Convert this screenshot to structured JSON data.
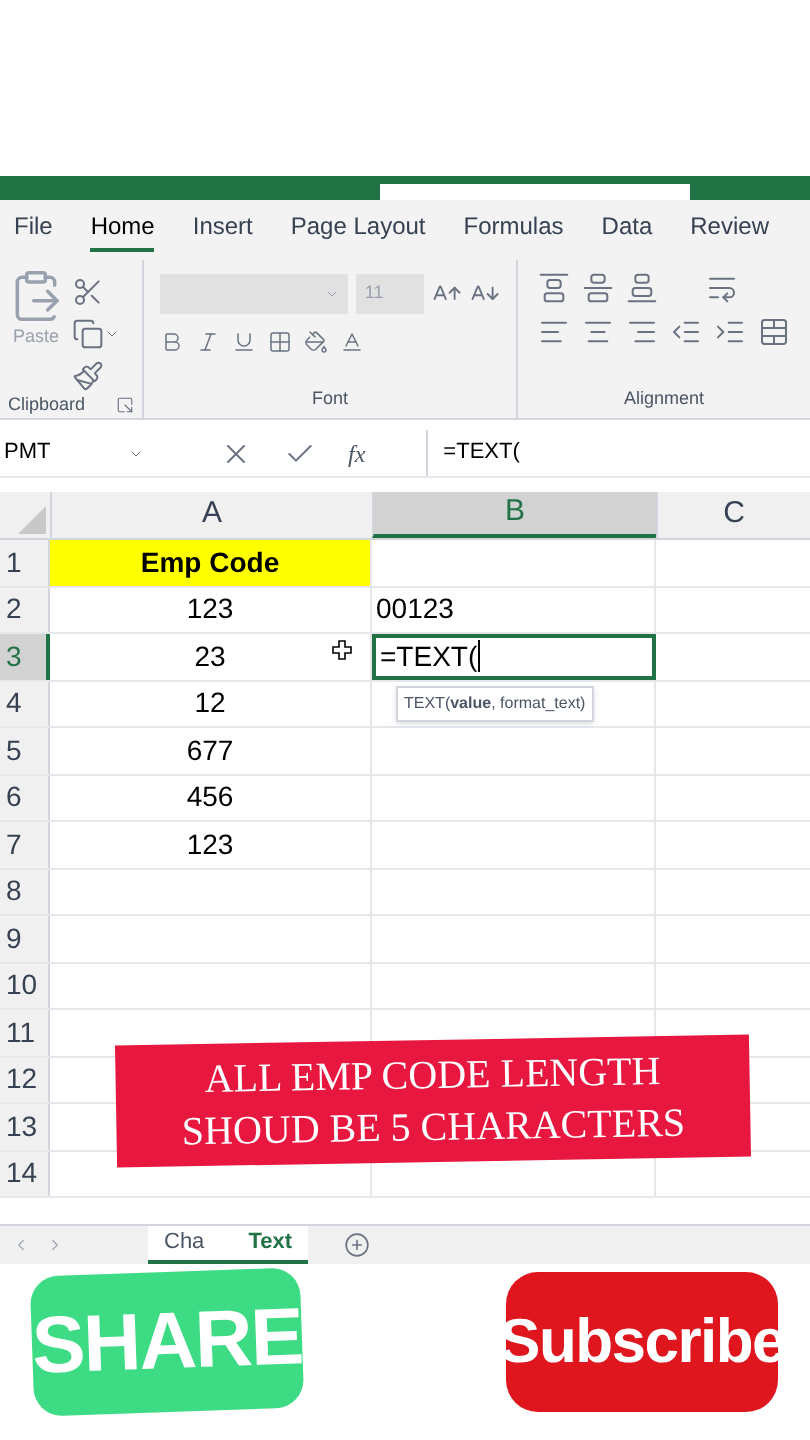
{
  "ribbon_tabs": [
    {
      "label": "File",
      "selected": false
    },
    {
      "label": "Home",
      "selected": true
    },
    {
      "label": "Insert",
      "selected": false
    },
    {
      "label": "Page Layout",
      "selected": false
    },
    {
      "label": "Formulas",
      "selected": false
    },
    {
      "label": "Data",
      "selected": false
    },
    {
      "label": "Review",
      "selected": false
    }
  ],
  "ribbon": {
    "paste_label": "Paste",
    "font_size": "11",
    "groups": [
      "Clipboard",
      "Font",
      "Alignment"
    ]
  },
  "formula_bar": {
    "name_box": "PMT",
    "fx_label": "fx",
    "formula": "=TEXT("
  },
  "columns": [
    {
      "label": "A",
      "selected": false
    },
    {
      "label": "B",
      "selected": true
    },
    {
      "label": "C",
      "selected": false
    }
  ],
  "rows": [
    {
      "label": "1",
      "selected": false,
      "a": "Emp Code",
      "highlighted": true
    },
    {
      "label": "2",
      "selected": false,
      "a": "123",
      "b": "00123"
    },
    {
      "label": "3",
      "selected": true,
      "a": "23",
      "b": "=TEXT(",
      "editing": true
    },
    {
      "label": "4",
      "selected": false,
      "a": "12"
    },
    {
      "label": "5",
      "selected": false,
      "a": "677"
    },
    {
      "label": "6",
      "selected": false,
      "a": "456"
    },
    {
      "label": "7",
      "selected": false,
      "a": "123"
    },
    {
      "label": "8",
      "selected": false
    },
    {
      "label": "9",
      "selected": false
    },
    {
      "label": "10",
      "selected": false
    },
    {
      "label": "11",
      "selected": false
    },
    {
      "label": "12",
      "selected": false
    },
    {
      "label": "13",
      "selected": false
    },
    {
      "label": "14",
      "selected": false
    }
  ],
  "tooltip": "TEXT(**value**, format_text)",
  "banner": [
    "ALL EMP CODE LENGTH",
    "SHOUD BE 5 CHARACTERS"
  ],
  "sheet_tab": {
    "parts": [
      "Cha",
      "Text"
    ],
    "selected": true
  },
  "stickers": {
    "share": "SHARE",
    "subscribe": "Subscribe"
  }
}
